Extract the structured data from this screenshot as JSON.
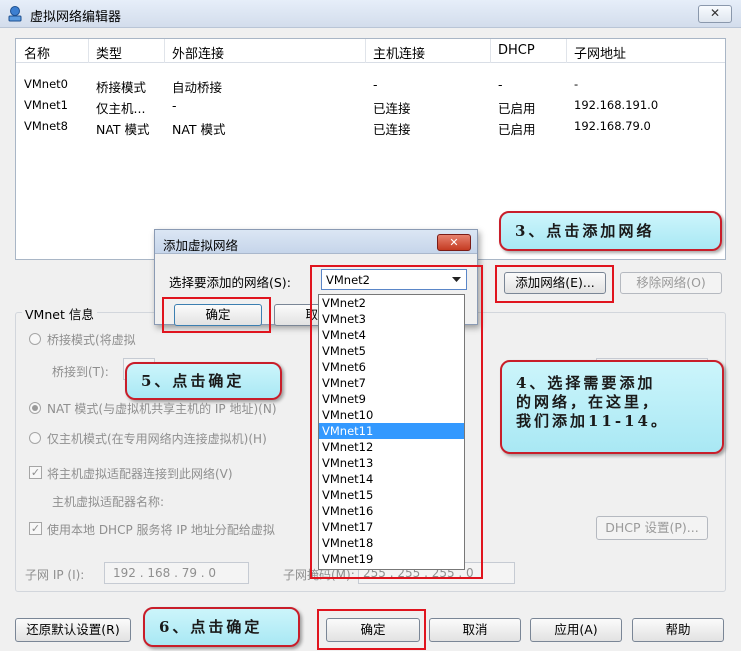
{
  "window": {
    "title": "虚拟网络编辑器",
    "close_label": "✕"
  },
  "networks": {
    "columns": [
      "名称",
      "类型",
      "外部连接",
      "主机连接",
      "DHCP",
      "子网地址"
    ],
    "rows": [
      [
        "VMnet0",
        "桥接模式",
        "自动桥接",
        "-",
        "-",
        "-"
      ],
      [
        "VMnet1",
        "仅主机...",
        "-",
        "已连接",
        "已启用",
        "192.168.191.0"
      ],
      [
        "VMnet8",
        "NAT 模式",
        "NAT 模式",
        "已连接",
        "已启用",
        "192.168.79.0"
      ]
    ]
  },
  "net_buttons": {
    "add": "添加网络(E)...",
    "remove": "移除网络(O)"
  },
  "vmnet_info": {
    "label": "VMnet 信息",
    "bridged": "桥接模式(将虚拟",
    "bridge_to": "桥接到(T):",
    "nat": "NAT 模式(与虚拟机共享主机的 IP 地址)(N)",
    "host_only": "仅主机模式(在专用网络内连接虚拟机)(H)",
    "connect_adapter": "将主机虚拟适配器连接到此网络(V)",
    "adapter_name": "主机虚拟适配器名称:",
    "use_dhcp": "使用本地 DHCP 服务将 IP 地址分配给虚拟",
    "dhcp_settings": "DHCP 设置(P)...",
    "subnet_ip_label": "子网 IP (I):",
    "subnet_ip": "192 . 168 . 79 . 0",
    "subnet_mask_label": "子网掩码(M):",
    "subnet_mask": "255 . 255 . 255 . 0"
  },
  "footer": {
    "restore": "还原默认设置(R)",
    "ok": "确定",
    "cancel": "取消",
    "apply": "应用(A)",
    "help": "帮助"
  },
  "add_dialog": {
    "title": "添加虚拟网络",
    "close_label": "✕",
    "select_label": "选择要添加的网络(S):",
    "selected": "VMnet2",
    "ok": "确定",
    "cancel": "取消",
    "options": [
      "VMnet2",
      "VMnet3",
      "VMnet4",
      "VMnet5",
      "VMnet6",
      "VMnet7",
      "VMnet9",
      "VMnet10",
      "VMnet11",
      "VMnet12",
      "VMnet13",
      "VMnet14",
      "VMnet15",
      "VMnet16",
      "VMnet17",
      "VMnet18",
      "VMnet19"
    ],
    "highlighted": "VMnet11"
  },
  "annotations": {
    "step3": "3、点击添加网络",
    "step4_line1": "4、选择需要添加",
    "step4_line2": "的网络，在这里，",
    "step4_line3": "我们添加11-14。",
    "step5": "5、点击确定",
    "step6": "6、点击确定"
  },
  "colors": {
    "highlight_red": "#e0141e",
    "callout_bg": "#b9eef7",
    "selection_blue": "#3399ff"
  }
}
